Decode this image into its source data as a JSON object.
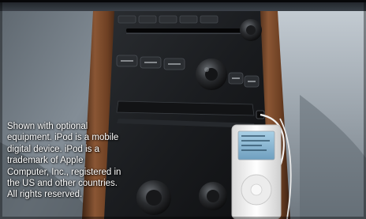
{
  "photo": {
    "subject": "car-dashboard-stereo-with-ipod",
    "colors": {
      "frame_top": "#2b3036",
      "dash_left": "#7f8891",
      "dash_right": "#a9b2ba",
      "wood": "#7a4a2a",
      "stereo": "#1b1d20",
      "ipod_body": "#f4f4f4",
      "ipod_screen": "#87b6d4"
    }
  },
  "caption": {
    "text": "Shown with optional\nequipment. iPod is a mobile\ndigital device. iPod is a\ntrademark of Apple\nComputer, Inc., registered in\nthe US and other countries.\nAll rights reserved."
  }
}
